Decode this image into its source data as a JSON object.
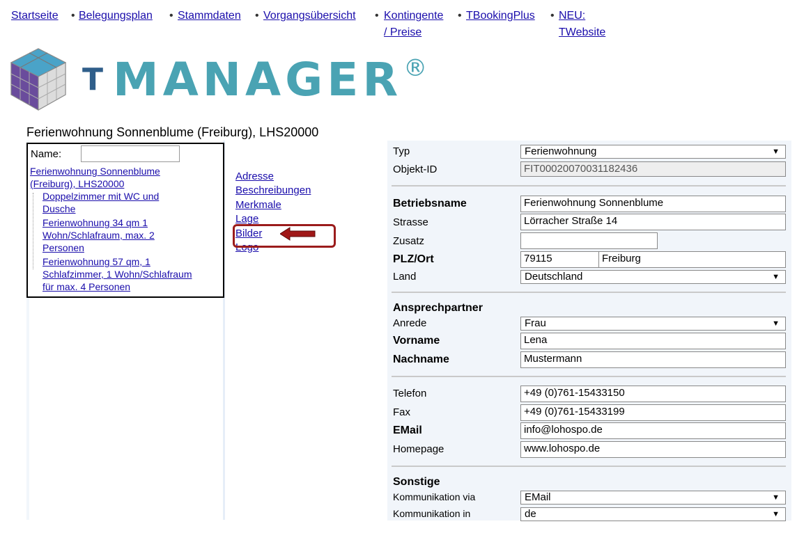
{
  "nav": {
    "items": [
      {
        "label": "Startseite"
      },
      {
        "label": "Belegungsplan"
      },
      {
        "label": "Stammdaten"
      },
      {
        "label": "Vorgangsübersicht"
      },
      {
        "label": "Kontingente",
        "label2": "/ Preise"
      },
      {
        "label": "TBookingPlus"
      },
      {
        "label": "NEU:",
        "label2": "TWebsite"
      }
    ],
    "separator": "•"
  },
  "logo": {
    "text": "MANAGER",
    "mark": "T",
    "registered": "®"
  },
  "page_title": "Ferienwohnung Sonnenblume (Freiburg), LHS20000",
  "tree": {
    "name_label": "Name:",
    "name_value": "",
    "root": [
      "Ferienwohnung Sonnenblume",
      "(Freiburg), LHS20000"
    ],
    "children": [
      [
        "Doppelzimmer mit WC und",
        "Dusche"
      ],
      [
        "Ferienwohnung 34 qm 1",
        "Wohn/Schlafraum, max. 2",
        "Personen"
      ],
      [
        "Ferienwohnung 57 qm, 1",
        "Schlafzimmer, 1 Wohn/Schlafraum",
        "für max. 4 Personen"
      ]
    ]
  },
  "sections": {
    "links": [
      "Adresse",
      "Beschreibungen",
      "Merkmale",
      "Lage",
      "Bilder",
      "Logo"
    ]
  },
  "form": {
    "typ": {
      "label": "Typ",
      "value": "Ferienwohnung"
    },
    "objekt_id": {
      "label": "Objekt-ID",
      "value": "FIT00020070031182436"
    },
    "betriebsname": {
      "label": "Betriebsname",
      "value": "Ferienwohnung Sonnenblume"
    },
    "strasse": {
      "label": "Strasse",
      "value": "Lörracher Straße 14"
    },
    "zusatz": {
      "label": "Zusatz",
      "value": ""
    },
    "plz_ort": {
      "label": "PLZ/Ort",
      "plz": "79115",
      "ort": "Freiburg"
    },
    "land": {
      "label": "Land",
      "value": "Deutschland"
    },
    "ansprechpartner": {
      "heading": "Ansprechpartner"
    },
    "anrede": {
      "label": "Anrede",
      "value": "Frau"
    },
    "vorname": {
      "label": "Vorname",
      "value": "Lena"
    },
    "nachname": {
      "label": "Nachname",
      "value": "Mustermann"
    },
    "telefon": {
      "label": "Telefon",
      "value": "+49 (0)761-15433150"
    },
    "fax": {
      "label": "Fax",
      "value": "+49 (0)761-15433199"
    },
    "email": {
      "label": "EMail",
      "value": "info@lohospo.de"
    },
    "homepage": {
      "label": "Homepage",
      "value": "www.lohospo.de"
    },
    "sonstige": {
      "heading": "Sonstige"
    },
    "kommunikation_via": {
      "label": "Kommunikation via",
      "value": "EMail"
    },
    "kommunikation_in": {
      "label": "Kommunikation in",
      "value": "de"
    }
  },
  "colors": {
    "link": "#1a0dab",
    "highlight": "#9b1c1c",
    "logo_teal": "#4aa3b3",
    "logo_blue": "#2f5e8a"
  }
}
